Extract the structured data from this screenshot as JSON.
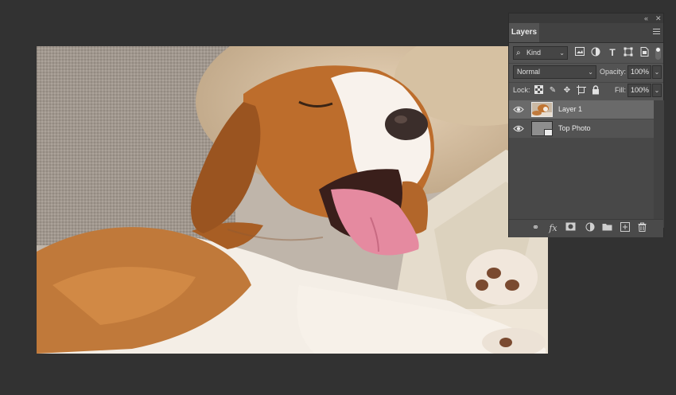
{
  "panel": {
    "collapse_label": "«",
    "close_label": "✕",
    "tab_label": "Layers",
    "filter": {
      "kind_label": "Kind",
      "icons": [
        "image-filter-icon",
        "adjustment-filter-icon",
        "type-filter-icon",
        "shape-filter-icon",
        "smart-object-filter-icon"
      ]
    },
    "blend_mode": "Normal",
    "opacity_label": "Opacity:",
    "opacity_value": "100%",
    "lock_label": "Lock:",
    "fill_label": "Fill:",
    "fill_value": "100%",
    "layers": [
      {
        "name": "Layer 1",
        "visible": true,
        "selected": true
      },
      {
        "name": "Top Photo",
        "visible": true,
        "selected": false,
        "smart_object": true
      }
    ],
    "footer_icons": [
      "link-layers-icon",
      "fx-icon",
      "add-mask-icon",
      "adjustment-layer-icon",
      "new-group-icon",
      "new-layer-icon",
      "delete-layer-icon"
    ]
  },
  "colors": {
    "app_bg": "#323232",
    "panel_bg": "#535353",
    "selected_row": "#6a6a6a"
  }
}
